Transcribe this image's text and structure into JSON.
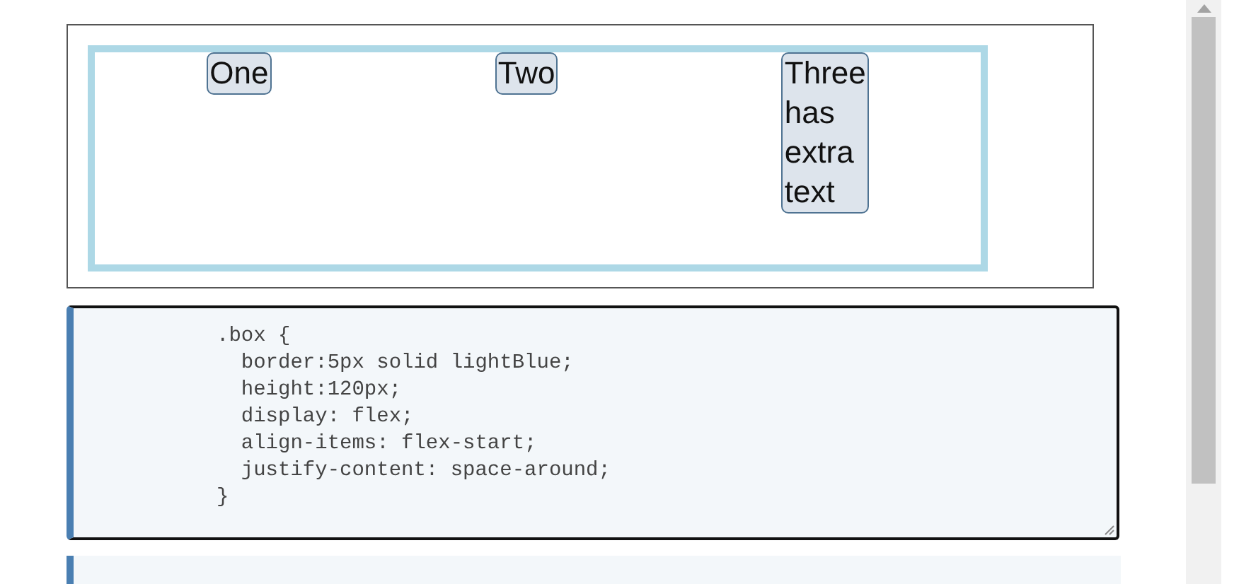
{
  "preview": {
    "items": [
      "One",
      "Two",
      "Three has extra text"
    ]
  },
  "editor": {
    "lines": [
      ".box {",
      "  border:5px solid lightBlue;",
      "  height:120px;",
      "  display: flex;",
      "  align-items: flex-start;",
      "  justify-content: space-around;",
      "}"
    ]
  }
}
